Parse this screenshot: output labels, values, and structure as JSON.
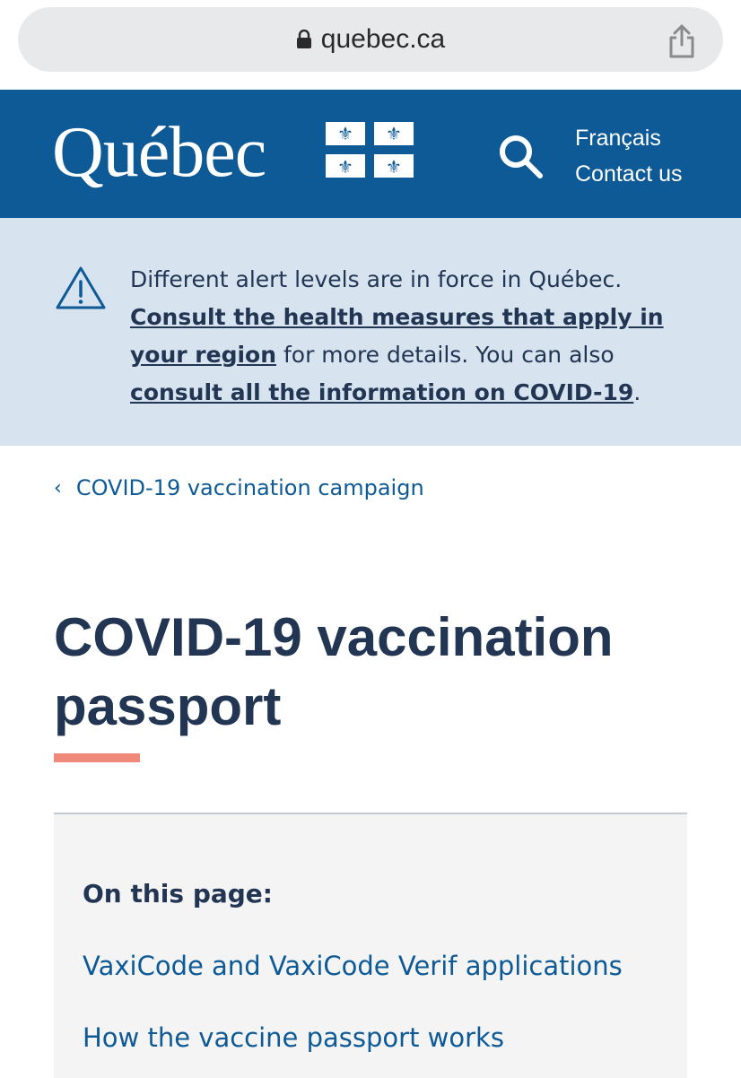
{
  "browser": {
    "url": "quebec.ca"
  },
  "header": {
    "logo_text": "Québec",
    "links": [
      "Français",
      "Contact us"
    ]
  },
  "alert": {
    "line1": "Different alert levels are in force in Québec.",
    "link1": "Consult the health measures that apply in your region",
    "mid": " for more details. You can also ",
    "link2": "consult all the information on COVID-19",
    "end": "."
  },
  "breadcrumb": {
    "label": "COVID-19 vaccination campaign"
  },
  "page": {
    "title": "COVID-19 vaccination passport"
  },
  "toc": {
    "title": "On this page:",
    "items": [
      "VaxiCode and VaxiCode Verif applications",
      "How the vaccine passport works"
    ]
  },
  "colors": {
    "header_blue": "#0d5a96",
    "alert_bg": "#d7e4f0",
    "title_navy": "#223654",
    "accent_salmon": "#ef8a7b"
  }
}
